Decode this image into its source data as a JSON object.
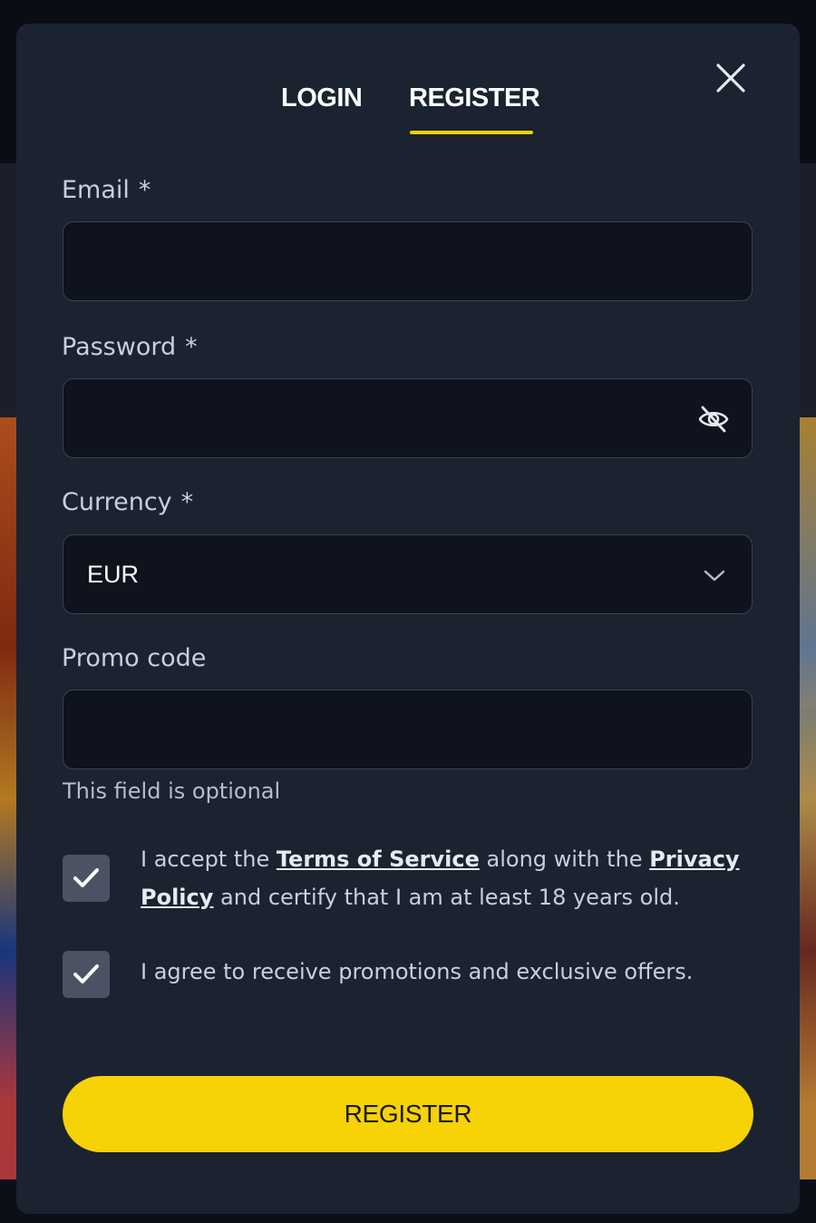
{
  "tabs": [
    {
      "label": "LOGIN",
      "active": false
    },
    {
      "label": "REGISTER",
      "active": true
    }
  ],
  "accent_color": "#f5cf06",
  "form": {
    "email": {
      "label": "Email",
      "required_mark": "*",
      "value": ""
    },
    "password": {
      "label": "Password",
      "required_mark": "*",
      "value": "",
      "toggle_icon": "eye-off-icon"
    },
    "currency": {
      "label": "Currency",
      "required_mark": "*",
      "selected": "EUR",
      "icon": "chevron-down-icon"
    },
    "promo": {
      "label": "Promo code",
      "value": "",
      "hint": "This field is optional"
    }
  },
  "consents": {
    "terms": {
      "checked": true,
      "text_before": "I accept the ",
      "terms_link": "Terms of Service",
      "text_middle": " along with the ",
      "privacy_link": "Privacy Policy",
      "text_after": " and certify that I am at least 18 years old."
    },
    "promotions": {
      "checked": true,
      "text": "I agree to receive promotions and exclusive offers."
    }
  },
  "submit_label": "REGISTER"
}
